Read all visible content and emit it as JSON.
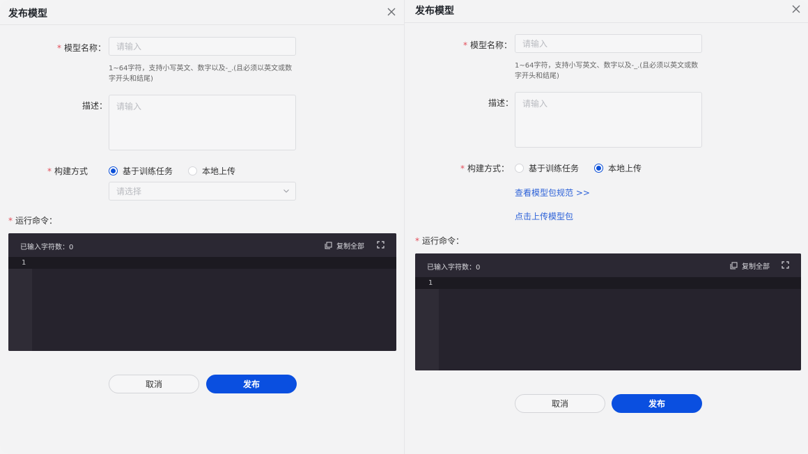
{
  "left": {
    "title": "发布模型",
    "form": {
      "name_label": "模型名称：",
      "name_placeholder": "请输入",
      "name_hint_line1": "1~64字符，支持小写英文、数字以及-_.(且必须以英文或数",
      "name_hint_line2": "字开头和结尾)",
      "desc_label": "描述：",
      "desc_placeholder": "请输入",
      "build_label": "构建方式",
      "build_options": [
        "基于训练任务",
        "本地上传"
      ],
      "build_selected": "基于训练任务",
      "task_select_placeholder": "请选择",
      "command_label": "运行命令："
    },
    "editor": {
      "char_count": "已输入字符数：0",
      "copy_label": "复制全部",
      "line_number": "1"
    },
    "buttons": {
      "cancel": "取消",
      "submit": "发布"
    }
  },
  "right": {
    "title": "发布模型",
    "form": {
      "name_label": "模型名称：",
      "name_placeholder": "请输入",
      "name_hint_line1": "1~64字符，支持小写英文、数字以及-_.(且必须以英文或数",
      "name_hint_line2": "字开头和结尾)",
      "desc_label": "描述：",
      "desc_placeholder": "请输入",
      "build_label": "构建方式：",
      "build_options": [
        "基于训练任务",
        "本地上传"
      ],
      "build_selected": "本地上传",
      "spec_link": "查看模型包规范 >>",
      "upload_link": "点击上传模型包",
      "command_label": "运行命令："
    },
    "editor": {
      "char_count": "已输入字符数：0",
      "copy_label": "复制全部",
      "line_number": "1"
    },
    "buttons": {
      "cancel": "取消",
      "submit": "发布"
    }
  },
  "colors": {
    "primary": "#0a4fe0",
    "required": "#e34d59",
    "link": "#2d62d8",
    "editor_bg": "#26232d"
  }
}
